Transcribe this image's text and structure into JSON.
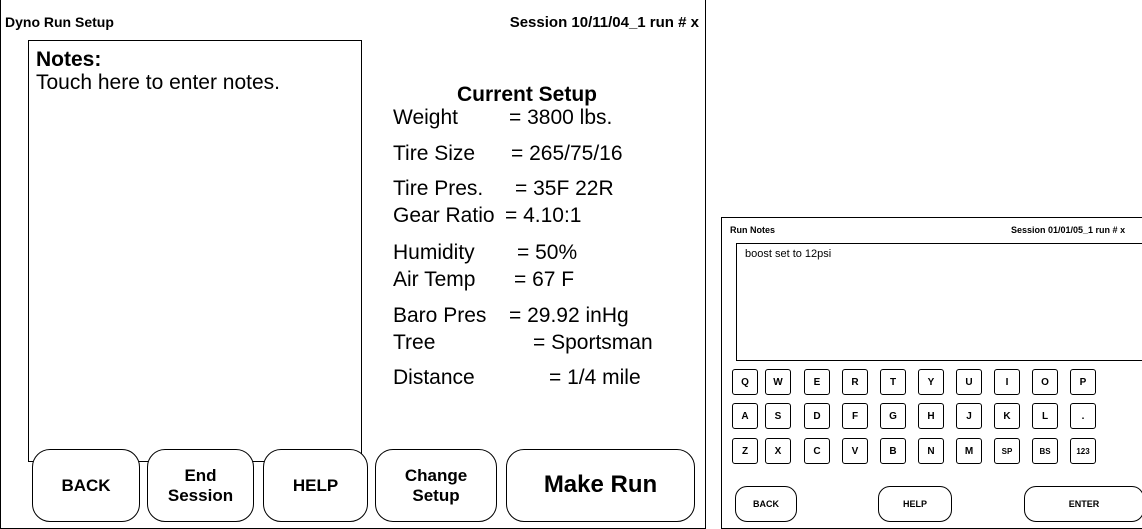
{
  "main": {
    "title": "Dyno Run Setup",
    "session": "Session  10/11/04_1  run # x",
    "notes": {
      "heading": "Notes:",
      "prompt": "Touch here to enter notes."
    },
    "setup": {
      "title": "Current Setup",
      "rows": [
        {
          "label": "Weight",
          "value": "= 3800 lbs."
        },
        {
          "label": "Tire Size",
          "value": "= 265/75/16"
        },
        {
          "label": "Tire Pres.",
          "value": "= 35F 22R"
        },
        {
          "label": "Gear Ratio",
          "value": "= 4.10:1"
        },
        {
          "label": "Humidity",
          "value": "= 50%"
        },
        {
          "label": "Air Temp",
          "value": "= 67 F"
        },
        {
          "label": "Baro Pres",
          "value": "= 29.92 inHg"
        },
        {
          "label": "Tree",
          "value": "= Sportsman"
        },
        {
          "label": "Distance",
          "value": "= 1/4 mile"
        }
      ]
    },
    "buttons": {
      "back": "BACK",
      "end_session_1": "End",
      "end_session_2": "Session",
      "help": "HELP",
      "change_setup_1": "Change",
      "change_setup_2": "Setup",
      "make_run": "Make Run"
    }
  },
  "popup": {
    "title": "Run Notes",
    "session": "Session 01/01/05_1 run # x",
    "notes_text": "boost set to 12psi",
    "keys": {
      "row1": [
        "Q",
        "W",
        "E",
        "R",
        "T",
        "Y",
        "U",
        "I",
        "O",
        "P"
      ],
      "row2": [
        "A",
        "S",
        "D",
        "F",
        "G",
        "H",
        "J",
        "K",
        "L",
        "."
      ],
      "row3": [
        "Z",
        "X",
        "C",
        "V",
        "B",
        "N",
        "M",
        "SP",
        "BS",
        "123"
      ]
    },
    "buttons": {
      "back": "BACK",
      "help": "HELP",
      "enter": "ENTER"
    }
  }
}
